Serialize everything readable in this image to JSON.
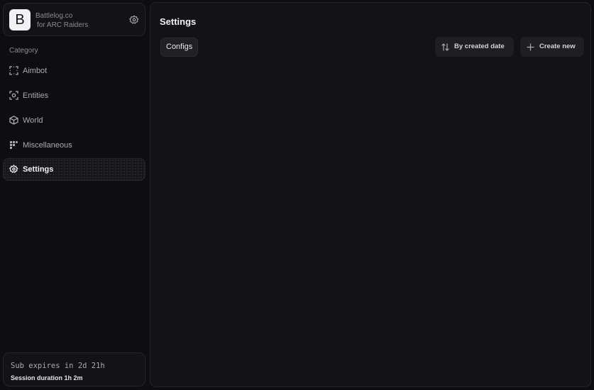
{
  "brand": {
    "logo_letter": "B",
    "name": "Battlelog.co",
    "subtitle": "for ARC Raiders",
    "settings_icon": "gear-icon"
  },
  "sidebar": {
    "category_label": "Category",
    "items": [
      {
        "label": "Aimbot",
        "icon": "crosshair-square-icon",
        "active": false
      },
      {
        "label": "Entities",
        "icon": "target-icon",
        "active": false
      },
      {
        "label": "World",
        "icon": "cube-icon",
        "active": false
      },
      {
        "label": "Miscellaneous",
        "icon": "grid-icon",
        "active": false
      },
      {
        "label": "Settings",
        "icon": "gear-icon",
        "active": true
      }
    ]
  },
  "status": {
    "sub_expires": "Sub expires in 2d 21h",
    "session_duration": "Session duration 1h  2m"
  },
  "main": {
    "title": "Settings",
    "tab_label": "Configs",
    "sort_button": {
      "label": "By created date",
      "icon": "sort-arrows-icon"
    },
    "create_button": {
      "label": "Create new",
      "icon": "plus-icon"
    }
  },
  "colors": {
    "background": "#0e0e10",
    "panel": "#131315",
    "border": "#25252a",
    "text_primary": "#f2f2f4",
    "text_muted": "#8b8b92"
  }
}
